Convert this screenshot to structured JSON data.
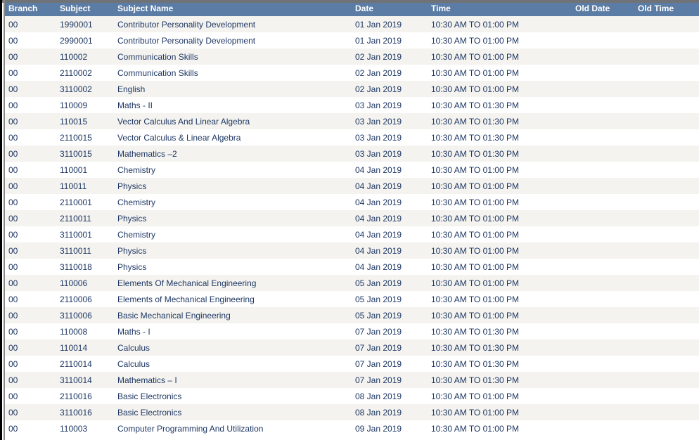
{
  "table": {
    "columns": [
      {
        "key": "branch",
        "label": "Branch",
        "class": "c-branch"
      },
      {
        "key": "subject",
        "label": "Subject",
        "class": "c-subject"
      },
      {
        "key": "name",
        "label": "Subject Name",
        "class": "c-name"
      },
      {
        "key": "date",
        "label": "Date",
        "class": "c-date"
      },
      {
        "key": "time",
        "label": "Time",
        "class": "c-time"
      },
      {
        "key": "old_date",
        "label": "Old Date",
        "class": "c-olddate"
      },
      {
        "key": "old_time",
        "label": "Old Time",
        "class": "c-oldtime"
      }
    ],
    "colors": {
      "header_background": "#5b7ca5",
      "header_text": "#ffffff",
      "row_odd_background": "#f4f3ef",
      "row_even_background": "#ffffff",
      "cell_text": "#1f3864",
      "top_rule": "#6f7377",
      "left_border": "#000000",
      "left_inner_rule": "#8a8a8a"
    },
    "rows": [
      {
        "branch": "00",
        "subject": "1990001",
        "name": "Contributor Personality Development",
        "date": "01 Jan 2019",
        "time": "10:30 AM TO 01:00 PM",
        "old_date": "",
        "old_time": ""
      },
      {
        "branch": "00",
        "subject": "2990001",
        "name": "Contributor Personality Development",
        "date": "01 Jan 2019",
        "time": "10:30 AM TO 01:00 PM",
        "old_date": "",
        "old_time": ""
      },
      {
        "branch": "00",
        "subject": "110002",
        "name": "Communication Skills",
        "date": "02 Jan 2019",
        "time": "10:30 AM TO 01:00 PM",
        "old_date": "",
        "old_time": ""
      },
      {
        "branch": "00",
        "subject": "2110002",
        "name": "Communication Skills",
        "date": "02 Jan 2019",
        "time": "10:30 AM TO 01:00 PM",
        "old_date": "",
        "old_time": ""
      },
      {
        "branch": "00",
        "subject": "3110002",
        "name": "English",
        "date": "02 Jan 2019",
        "time": "10:30 AM TO 01:00 PM",
        "old_date": "",
        "old_time": ""
      },
      {
        "branch": "00",
        "subject": "110009",
        "name": "Maths - II",
        "date": "03 Jan 2019",
        "time": "10:30 AM TO 01:30 PM",
        "old_date": "",
        "old_time": ""
      },
      {
        "branch": "00",
        "subject": "110015",
        "name": "Vector Calculus And Linear Algebra",
        "date": "03 Jan 2019",
        "time": "10:30 AM TO 01:30 PM",
        "old_date": "",
        "old_time": ""
      },
      {
        "branch": "00",
        "subject": "2110015",
        "name": "Vector Calculus & Linear Algebra",
        "date": "03 Jan 2019",
        "time": "10:30 AM TO 01:30 PM",
        "old_date": "",
        "old_time": ""
      },
      {
        "branch": "00",
        "subject": "3110015",
        "name": "Mathematics –2",
        "date": "03 Jan 2019",
        "time": "10:30 AM TO 01:30 PM",
        "old_date": "",
        "old_time": ""
      },
      {
        "branch": "00",
        "subject": "110001",
        "name": "Chemistry",
        "date": "04 Jan 2019",
        "time": "10:30 AM TO 01:00 PM",
        "old_date": "",
        "old_time": ""
      },
      {
        "branch": "00",
        "subject": "110011",
        "name": "Physics",
        "date": "04 Jan 2019",
        "time": "10:30 AM TO 01:00 PM",
        "old_date": "",
        "old_time": ""
      },
      {
        "branch": "00",
        "subject": "2110001",
        "name": "Chemistry",
        "date": "04 Jan 2019",
        "time": "10:30 AM TO 01:00 PM",
        "old_date": "",
        "old_time": ""
      },
      {
        "branch": "00",
        "subject": "2110011",
        "name": "Physics",
        "date": "04 Jan 2019",
        "time": "10:30 AM TO 01:00 PM",
        "old_date": "",
        "old_time": ""
      },
      {
        "branch": "00",
        "subject": "3110001",
        "name": "Chemistry",
        "date": "04 Jan 2019",
        "time": "10:30 AM TO 01:00 PM",
        "old_date": "",
        "old_time": ""
      },
      {
        "branch": "00",
        "subject": "3110011",
        "name": "Physics",
        "date": "04 Jan 2019",
        "time": "10:30 AM TO 01:00 PM",
        "old_date": "",
        "old_time": ""
      },
      {
        "branch": "00",
        "subject": "3110018",
        "name": "Physics",
        "date": "04 Jan 2019",
        "time": "10:30 AM TO 01:00 PM",
        "old_date": "",
        "old_time": ""
      },
      {
        "branch": "00",
        "subject": "110006",
        "name": "Elements Of Mechanical Engineering",
        "date": "05 Jan 2019",
        "time": "10:30 AM TO 01:00 PM",
        "old_date": "",
        "old_time": ""
      },
      {
        "branch": "00",
        "subject": "2110006",
        "name": "Elements of Mechanical Engineering",
        "date": "05 Jan 2019",
        "time": "10:30 AM TO 01:00 PM",
        "old_date": "",
        "old_time": ""
      },
      {
        "branch": "00",
        "subject": "3110006",
        "name": "Basic Mechanical Engineering",
        "date": "05 Jan 2019",
        "time": "10:30 AM TO 01:00 PM",
        "old_date": "",
        "old_time": ""
      },
      {
        "branch": "00",
        "subject": "110008",
        "name": "Maths - I",
        "date": "07 Jan 2019",
        "time": "10:30 AM TO 01:30 PM",
        "old_date": "",
        "old_time": ""
      },
      {
        "branch": "00",
        "subject": "110014",
        "name": "Calculus",
        "date": "07 Jan 2019",
        "time": "10:30 AM TO 01:30 PM",
        "old_date": "",
        "old_time": ""
      },
      {
        "branch": "00",
        "subject": "2110014",
        "name": "Calculus",
        "date": "07 Jan 2019",
        "time": "10:30 AM TO 01:30 PM",
        "old_date": "",
        "old_time": ""
      },
      {
        "branch": "00",
        "subject": "3110014",
        "name": "Mathematics – I",
        "date": "07 Jan 2019",
        "time": "10:30 AM TO 01:30 PM",
        "old_date": "",
        "old_time": ""
      },
      {
        "branch": "00",
        "subject": "2110016",
        "name": "Basic Electronics",
        "date": "08 Jan 2019",
        "time": "10:30 AM TO 01:00 PM",
        "old_date": "",
        "old_time": ""
      },
      {
        "branch": "00",
        "subject": "3110016",
        "name": "Basic Electronics",
        "date": "08 Jan 2019",
        "time": "10:30 AM TO 01:00 PM",
        "old_date": "",
        "old_time": ""
      },
      {
        "branch": "00",
        "subject": "110003",
        "name": "Computer Programming And Utilization",
        "date": "09 Jan 2019",
        "time": "10:30 AM TO 01:00 PM",
        "old_date": "",
        "old_time": ""
      }
    ]
  }
}
